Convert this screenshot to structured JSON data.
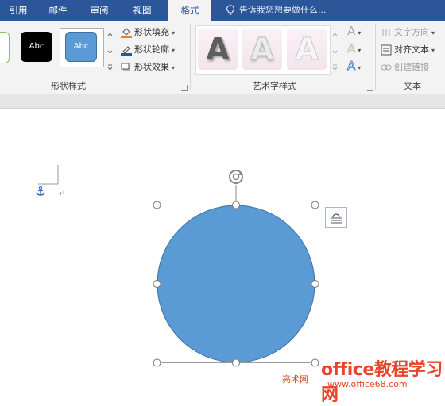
{
  "tabs": [
    {
      "label": "引用",
      "active": false
    },
    {
      "label": "邮件",
      "active": false
    },
    {
      "label": "审阅",
      "active": false
    },
    {
      "label": "视图",
      "active": false
    },
    {
      "label": "格式",
      "active": true
    }
  ],
  "tell_me": "告诉我您想要做什么...",
  "shape_styles": {
    "label": "形状样式",
    "tiles": [
      {
        "text": "Abc",
        "fill": "#000000",
        "color": "#ffffff"
      },
      {
        "text": "Abc",
        "fill": "#5b9bd5",
        "color": "#ffffff"
      }
    ],
    "fill_label": "形状填充",
    "outline_label": "形状轮廓",
    "effects_label": "形状效果"
  },
  "wordart_styles": {
    "label": "艺术字样式",
    "letter": "A"
  },
  "text_group": {
    "label": "文本",
    "direction_label": "文字方向",
    "align_label": "对齐文本",
    "link_label": "创建链接"
  },
  "colors": {
    "ribbon_blue": "#2b579a",
    "shape_fill": "#5b9bd5",
    "anchor": "#2f6dbd"
  },
  "watermark": {
    "prefix": "亮术网",
    "main": "office教程学习网",
    "url": "www.office68.com"
  }
}
